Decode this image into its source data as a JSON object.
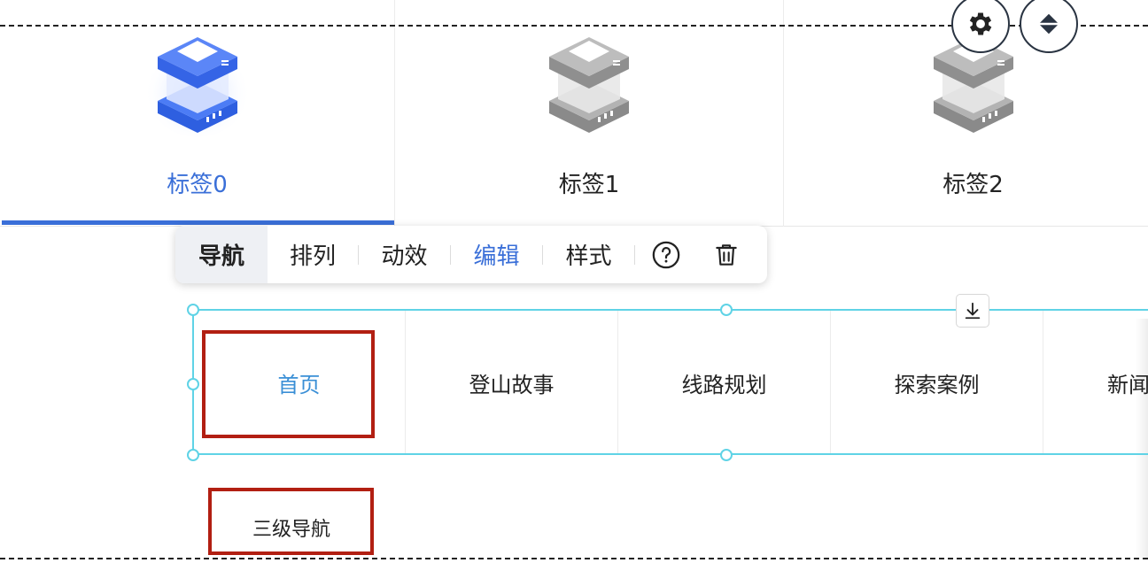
{
  "tabs": [
    {
      "label": "标签0",
      "icon": "server-icon-blue",
      "active": true
    },
    {
      "label": "标签1",
      "icon": "server-icon-gray",
      "active": false
    },
    {
      "label": "标签2",
      "icon": "server-icon-gray",
      "active": false
    }
  ],
  "floating_buttons": [
    {
      "icon": "gear-icon"
    },
    {
      "icon": "sort-arrows-icon"
    }
  ],
  "toolbar": {
    "items": [
      "导航",
      "排列",
      "动效",
      "编辑",
      "样式"
    ],
    "active_item": "导航",
    "highlighted_item": "编辑",
    "icons": [
      "help-icon",
      "trash-icon"
    ]
  },
  "download_button": {
    "icon": "download-icon"
  },
  "nav": {
    "items": [
      "首页",
      "登山故事",
      "线路规划",
      "探索案例",
      "新闻"
    ],
    "active_item": "首页"
  },
  "sub_nav_label": "三级导航",
  "colors": {
    "accent_blue": "#3a6fd8",
    "link_blue": "#3a8fd6",
    "selection_cyan": "#5fd3e6",
    "highlight_red": "#b21f12",
    "toolbar_active_bg": "#eef0f4"
  }
}
